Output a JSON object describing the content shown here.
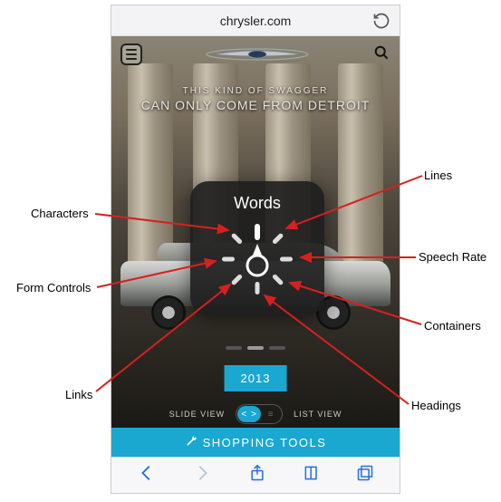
{
  "browser": {
    "url": "chrysler.com",
    "reload_label": "Reload"
  },
  "header": {
    "menu_label": "Menu",
    "logo_alt": "Chrysler",
    "search_label": "Search"
  },
  "hero": {
    "line1": "THIS KIND OF SWAGGER",
    "line2": "CAN ONLY COME FROM DETROIT"
  },
  "year_button": "2013",
  "view_toggle": {
    "slide": "SLIDE VIEW",
    "list": "LIST VIEW"
  },
  "shopping_bar": "SHOPPING TOOLS",
  "rotor": {
    "title": "Words",
    "options": [
      "Words",
      "Lines",
      "Speech Rate",
      "Containers",
      "Headings",
      "Links",
      "Form Controls",
      "Characters"
    ]
  },
  "callouts": {
    "lines": "Lines",
    "characters": "Characters",
    "speech_rate": "Speech Rate",
    "form_controls": "Form Controls",
    "containers": "Containers",
    "links": "Links",
    "headings": "Headings"
  },
  "toolbar": {
    "back": "Back",
    "forward": "Forward",
    "share": "Share",
    "bookmarks": "Bookmarks",
    "tabs": "Tabs"
  }
}
